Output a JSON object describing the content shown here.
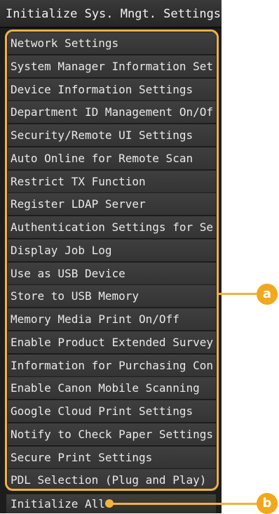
{
  "screen": {
    "title": "Initialize Sys. Mngt. Settings"
  },
  "menu": {
    "items": [
      "Network Settings",
      "System Manager Information Set",
      "Device Information Settings",
      "Department ID Management On/Of",
      "Security/Remote UI Settings",
      "Auto Online for Remote Scan",
      "Restrict TX Function",
      "Register LDAP Server",
      "Authentication Settings for Se",
      "Display Job Log",
      "Use as USB Device",
      "Store to USB Memory",
      "Memory Media Print On/Off",
      "Enable Product Extended Survey",
      "Information for Purchasing Con",
      "Enable Canon Mobile Scanning",
      "Google Cloud Print Settings",
      "Notify to Check Paper Settings",
      "Secure Print Settings",
      "PDL Selection (Plug and Play)"
    ],
    "bottom_item": "Initialize All"
  },
  "callouts": {
    "a": "a",
    "b": "b",
    "color": "#f2a81d"
  }
}
